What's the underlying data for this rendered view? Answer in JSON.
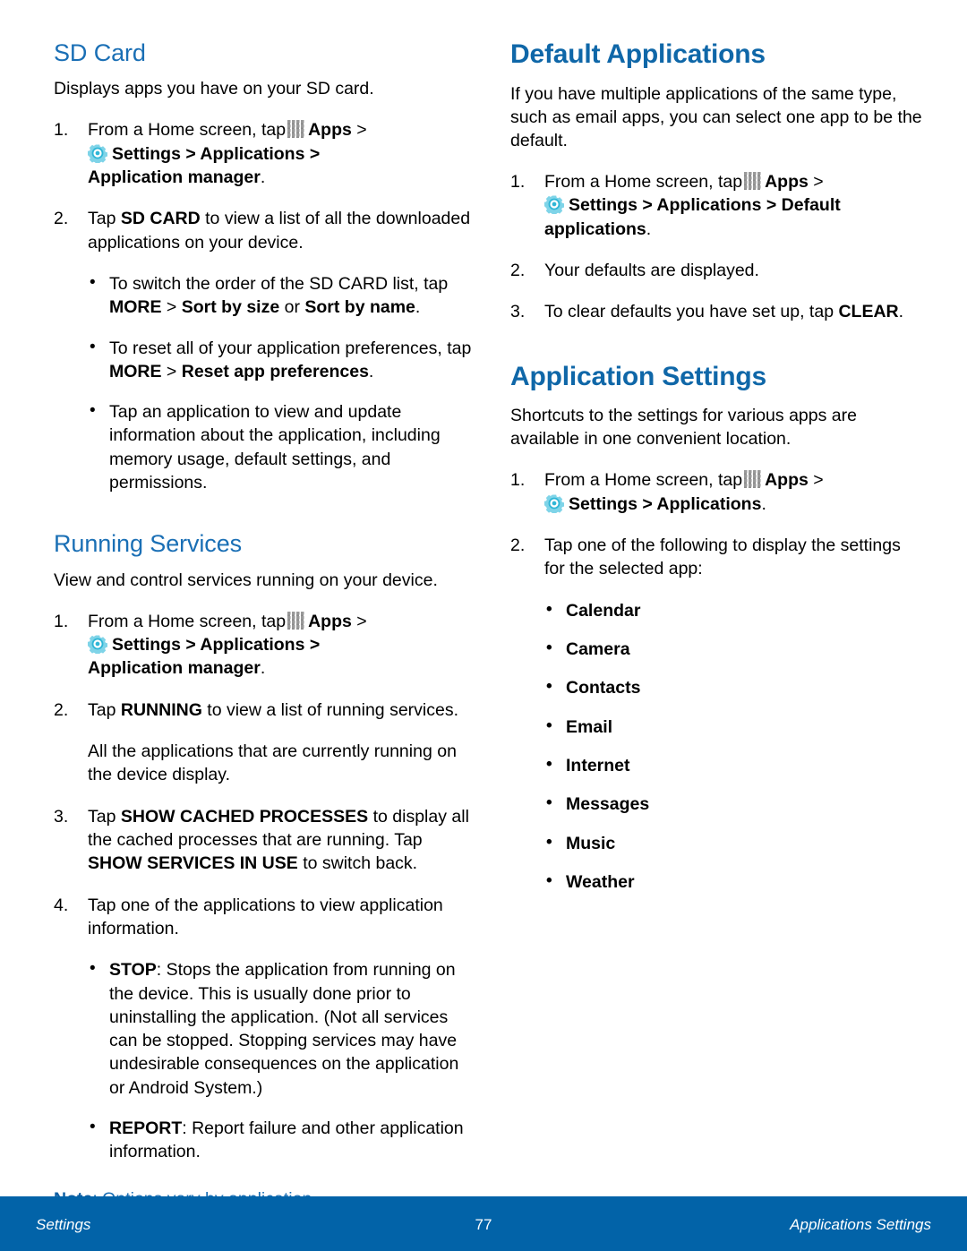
{
  "document": {
    "page_number": "77",
    "footer_left": "Settings",
    "footer_right": "Applications Settings",
    "accent_blue": "#0f67a8",
    "heading_blue": "#1a6fb5",
    "footer_blue": "#0263a8",
    "gear_icon_color": "#2fb6d6",
    "apps_icon_color": "#8d8d8d"
  },
  "left_column": {
    "sd_card": {
      "heading": "SD Card",
      "intro": "Displays apps you have on your SD card.",
      "step1": {
        "lead": "From a Home screen, tap",
        "apps_label": "Apps",
        "sep1": ">",
        "settings_path": "Settings > Applications >",
        "path_tail": "Application manager",
        "period": "."
      },
      "step2": {
        "pre": "Tap",
        "bold": "SD CARD",
        "post": "to view a list of all the downloaded applications on your device."
      },
      "bullets": [
        {
          "pre": "To switch the order of the SD CARD list, tap",
          "bold1": "MORE",
          "mid1": ">",
          "bold2": "Sort by size",
          "mid2": "or",
          "bold3": "Sort by name",
          "post": "."
        },
        {
          "pre": "To reset all of your application preferences, tap",
          "bold1": "MORE",
          "mid1": ">",
          "bold2": "Reset app preferences",
          "post": "."
        },
        {
          "plain": "Tap an application to view and update information about the application, including memory usage, default settings, and permissions."
        }
      ]
    },
    "running_services": {
      "heading": "Running Services",
      "intro": "View and control services running on your device.",
      "step1": {
        "lead": "From a Home screen, tap",
        "apps_label": "Apps",
        "sep1": ">",
        "settings_path": "Settings > Applications >",
        "path_tail": "Application manager",
        "period": "."
      },
      "step2": {
        "pre": "Tap",
        "bold": "RUNNING",
        "post": "to view a list of running services."
      },
      "step2_note": "All the applications that are currently running on the device display.",
      "step3": {
        "pre": "Tap",
        "bold1": "SHOW CACHED PROCESSES",
        "mid": "to display all the cached processes that are running. Tap",
        "bold2": "SHOW SERVICES IN USE",
        "post": "to switch back."
      },
      "step4": "Tap one of the applications to view application information.",
      "bullets": [
        {
          "bold": "STOP",
          "text": ": Stops the application from running on the device. This is usually done prior to uninstalling the application. (Not all services can be stopped. Stopping services may have undesirable consequences on the application or Android System.)"
        },
        {
          "bold": "REPORT",
          "text": ": Report failure and other application information."
        }
      ],
      "note_label": "Note",
      "note_text": ": Options vary by application."
    }
  },
  "right_column": {
    "default_applications": {
      "heading": "Default Applications",
      "intro": "If you have multiple applications of the same type, such as email apps, you can select one app to be the default.",
      "step1": {
        "lead": "From a Home screen, tap",
        "apps_label": "Apps",
        "sep1": ">",
        "settings_path": "Settings > Applications > Default",
        "path_tail": "applications",
        "period": "."
      },
      "step2": "Your defaults are displayed.",
      "step3": {
        "pre": "To clear defaults you have set up, tap",
        "bold": "CLEAR",
        "post": "."
      }
    },
    "application_settings": {
      "heading": "Application Settings",
      "intro": "Shortcuts to the settings for various apps are available in one convenient location.",
      "step1": {
        "lead": "From a Home screen, tap",
        "apps_label": "Apps",
        "sep1": ">",
        "settings_path": "Settings > Applications",
        "period": "."
      },
      "step2": "Tap one of the following to display the settings for the selected app:",
      "app_list": [
        "Calendar",
        "Camera",
        "Contacts",
        "Email",
        "Internet",
        "Messages",
        "Music",
        "Weather"
      ]
    }
  }
}
